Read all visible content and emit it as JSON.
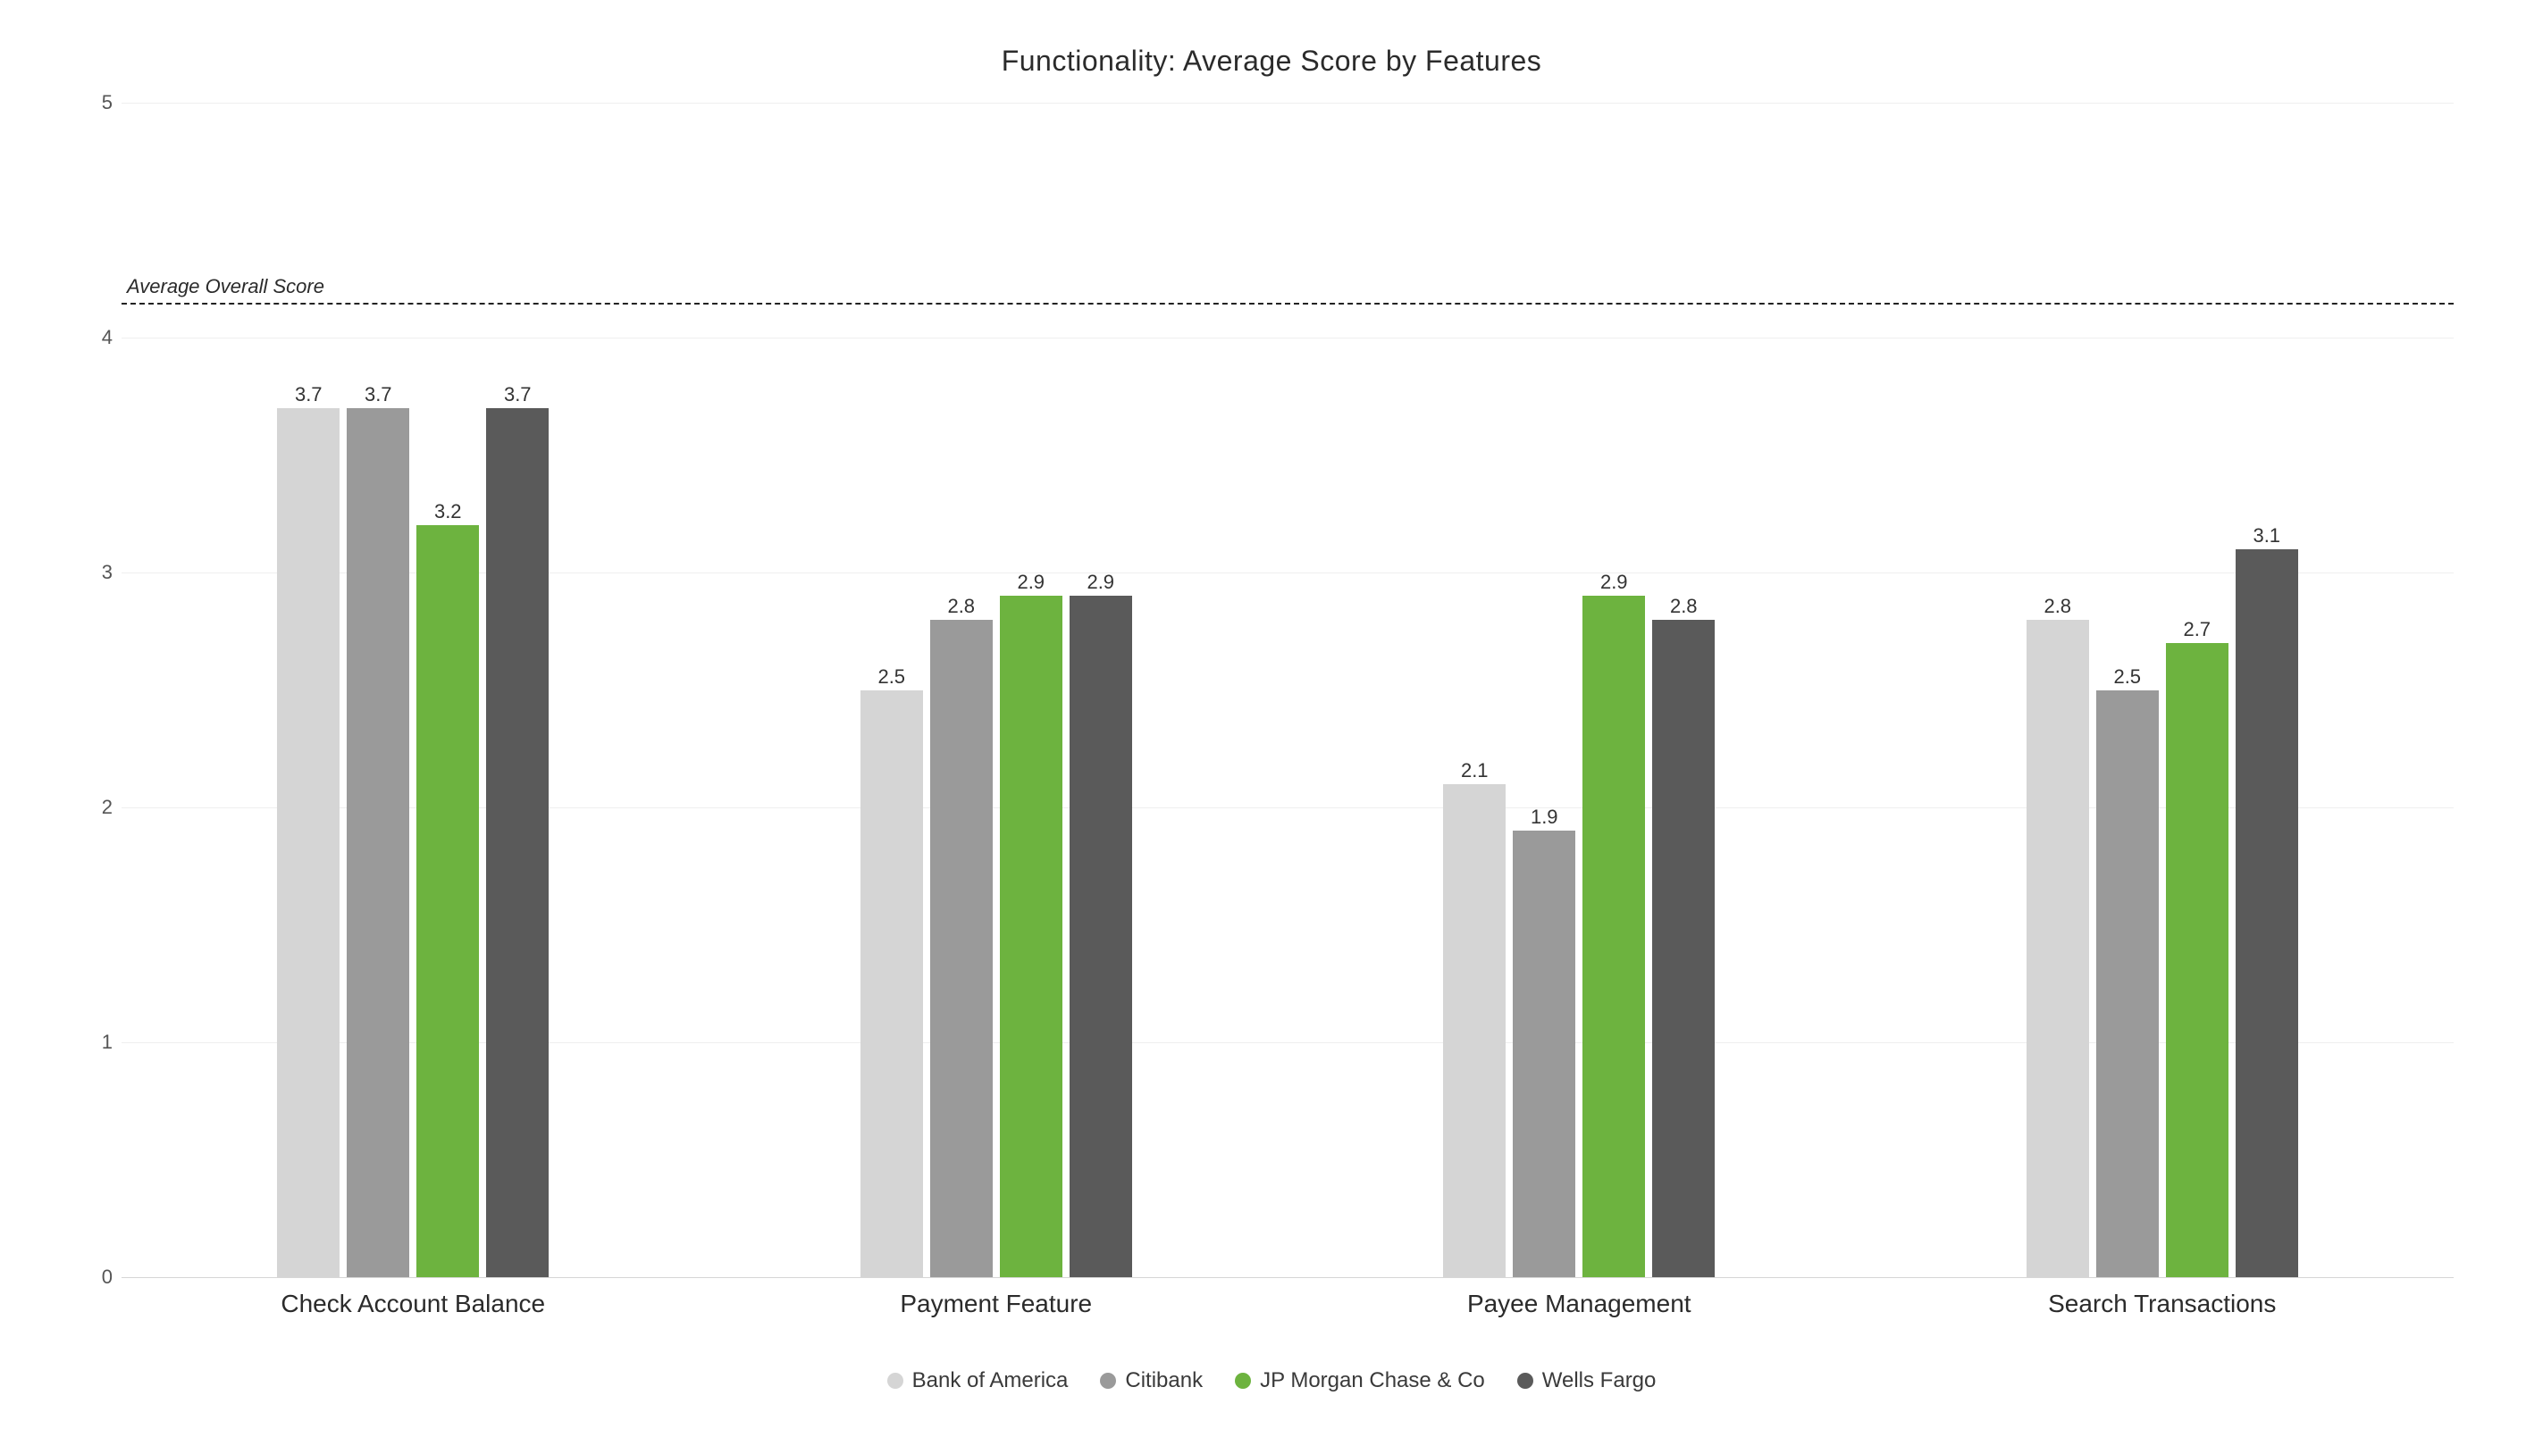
{
  "chart_data": {
    "type": "bar",
    "title": "Functionality: Average Score by Features",
    "xlabel": "",
    "ylabel": "",
    "ylim": [
      0,
      5
    ],
    "yticks": [
      0,
      1,
      2,
      3,
      4,
      5
    ],
    "categories": [
      "Check Account Balance",
      "Payment Feature",
      "Payee Management",
      "Search Transactions"
    ],
    "series": [
      {
        "name": "Bank of America",
        "color": "#d5d5d5",
        "values": [
          3.7,
          2.5,
          2.1,
          2.8
        ]
      },
      {
        "name": "Citibank",
        "color": "#9a9a9a",
        "values": [
          3.7,
          2.8,
          1.9,
          2.5
        ]
      },
      {
        "name": "JP Morgan Chase & Co",
        "color": "#6db33f",
        "values": [
          3.2,
          2.9,
          2.9,
          2.7
        ]
      },
      {
        "name": "Wells Fargo",
        "color": "#5a5a5a",
        "values": [
          3.7,
          2.9,
          2.8,
          3.1
        ]
      }
    ],
    "reference_line": {
      "label": "Average Overall Score",
      "value": 4.15
    }
  }
}
